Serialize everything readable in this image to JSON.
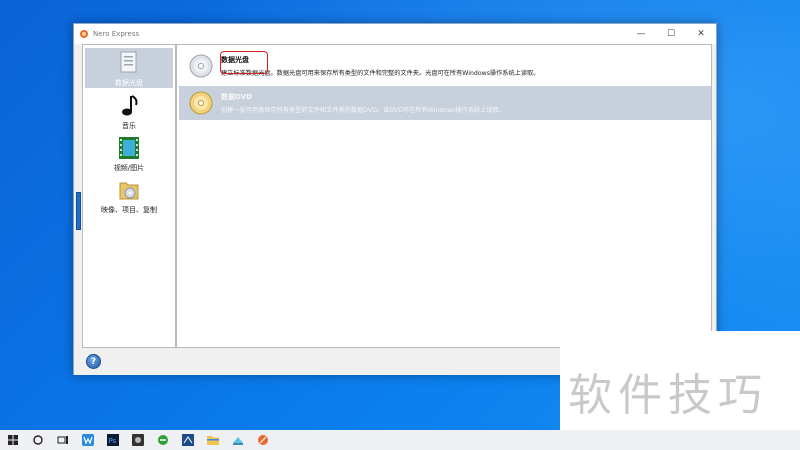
{
  "window": {
    "title": "Nero Express",
    "minimize_glyph": "—",
    "maximize_glyph": "☐",
    "close_glyph": "✕"
  },
  "categories": [
    {
      "label": "数据光盘",
      "icon": "data-disc-icon",
      "selected": true
    },
    {
      "label": "音乐",
      "icon": "music-note-icon",
      "selected": false
    },
    {
      "label": "视频/图片",
      "icon": "film-icon",
      "selected": false
    },
    {
      "label": "映像、项目、复制",
      "icon": "folder-disc-icon",
      "selected": false
    }
  ],
  "tasks": [
    {
      "title": "数据光盘",
      "description": "建立标准数据光盘。数据光盘可用来保存所有类型的文件和完整的文件夹。光盘可在所有Windows操作系统上读取。",
      "icon": "cd-icon",
      "selected": false
    },
    {
      "title": "数据DVD",
      "description": "创建一张可用来保存所有类型的文件和文件夹的数据DVD。该DVD可在所有Windows操作系统上读取。",
      "icon": "dvd-icon",
      "selected": true
    }
  ],
  "help": {
    "glyph": "?"
  },
  "watermark": {
    "text": "软件技巧"
  },
  "taskbar": {
    "items": [
      "start-icon",
      "search-icon",
      "task-view-icon",
      "wps-icon",
      "photoshop-icon",
      "camera-app-icon",
      "browser-icon",
      "nero-tool-icon",
      "file-explorer-icon",
      "app-icon",
      "nero-express-icon"
    ]
  },
  "colors": {
    "accent": "#1f6fc7",
    "selected_bg": "#c8d0db",
    "highlight": "#d42020"
  }
}
